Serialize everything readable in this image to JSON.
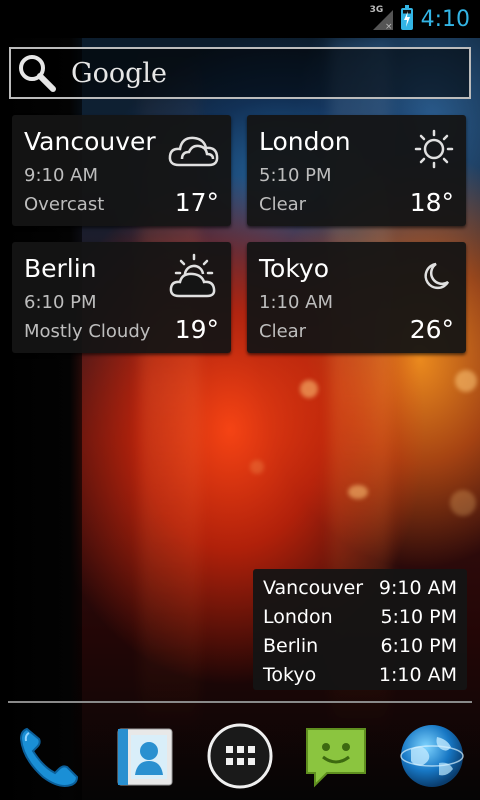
{
  "status_bar": {
    "network": "3G",
    "time": "4:10",
    "accent": "#33b5e5"
  },
  "search_widget": {
    "logo_text": "Google",
    "icon": "search-icon"
  },
  "weather": [
    {
      "city": "Vancouver",
      "time": "9:10 AM",
      "condition": "Overcast",
      "temp": "17°",
      "icon": "cloud-icon"
    },
    {
      "city": "London",
      "time": "5:10 PM",
      "condition": "Clear",
      "temp": "18°",
      "icon": "sun-icon"
    },
    {
      "city": "Berlin",
      "time": "6:10 PM",
      "condition": "Mostly Cloudy",
      "temp": "19°",
      "icon": "partly-cloudy-icon"
    },
    {
      "city": "Tokyo",
      "time": "1:10 AM",
      "condition": "Clear",
      "temp": "26°",
      "icon": "moon-icon"
    }
  ],
  "world_clock": [
    {
      "city": "Vancouver",
      "time": "9:10 AM"
    },
    {
      "city": "London",
      "time": "5:10 PM"
    },
    {
      "city": "Berlin",
      "time": "6:10 PM"
    },
    {
      "city": "Tokyo",
      "time": "1:10 AM"
    }
  ],
  "dock": {
    "items": [
      "phone-icon",
      "contacts-icon",
      "app-drawer-icon",
      "messaging-icon",
      "browser-icon"
    ]
  }
}
